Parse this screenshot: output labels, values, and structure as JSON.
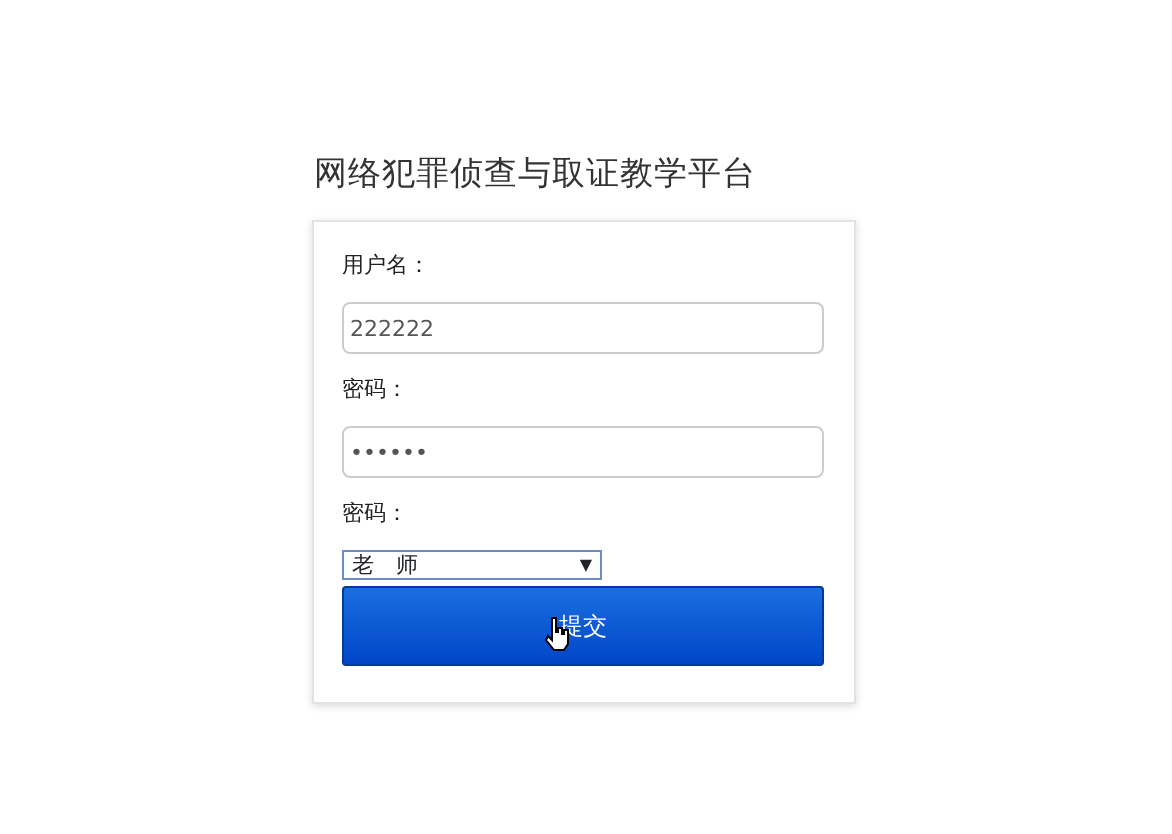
{
  "title": "网络犯罪侦查与取证教学平台",
  "fields": [
    {
      "kind": "text",
      "label": "用户名：",
      "value": "222222"
    },
    {
      "kind": "text",
      "label": "密码：",
      "value": "••••••"
    },
    {
      "kind": "select",
      "label": "密码：",
      "value": "老　师",
      "arrow": "▼"
    }
  ],
  "submit": {
    "label": "提交",
    "hovered": true
  }
}
